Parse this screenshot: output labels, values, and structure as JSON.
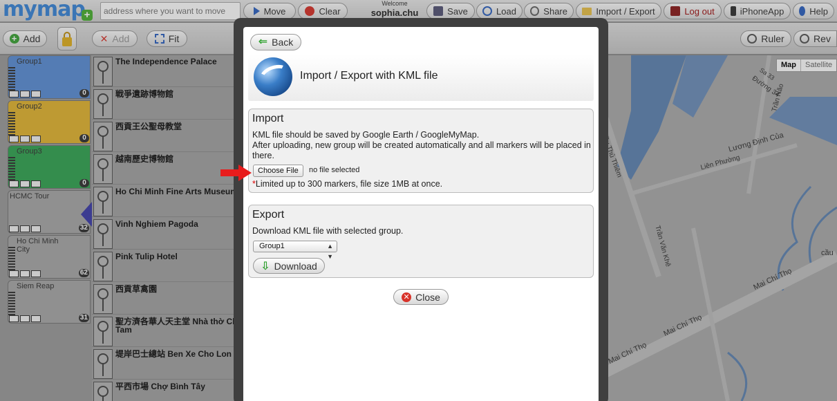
{
  "topbar": {
    "logo": "mymap",
    "address_placeholder": "address where you want to move",
    "buttons": {
      "move": "Move",
      "clear": "Clear",
      "save": "Save",
      "load": "Load",
      "share": "Share",
      "import_export": "Import / Export",
      "logout": "Log out",
      "iphone": "iPhoneApp",
      "help": "Help"
    },
    "welcome_label": "Welcome",
    "username": "sophia.chu"
  },
  "toolbar2": {
    "add": "Add",
    "add_disabled": "Add",
    "fit": "Fit",
    "ruler": "Ruler",
    "rev": "Rev"
  },
  "groups": [
    {
      "name": "Group1",
      "count": "0",
      "color": "#5b8fd6"
    },
    {
      "name": "Group2",
      "count": "0",
      "color": "#e3b531"
    },
    {
      "name": "Group3",
      "count": "0",
      "color": "#32a452"
    },
    {
      "name": "HCMC Tour",
      "count": "32",
      "color": "#a8a8a8"
    },
    {
      "name": "Ho Chi Minh City",
      "count": "62",
      "color": "#a8a8a8"
    },
    {
      "name": "Siem Reap",
      "count": "31",
      "color": "#a8a8a8"
    }
  ],
  "markers": [
    "The Independence Palace",
    "戦爭遺跡博物館",
    "西貢王公聖母教堂",
    "越南歷史博物館",
    "Ho Chi Minh Fine Arts Museum",
    "Vinh Nghiem Pagoda",
    "Pink Tulip Hotel",
    "西貢草禽園",
    "聖方濟各華人天主堂 Nhà thờ Cha Tam",
    "堤岸巴士總站 Ben Xe Cho Lon",
    "平西市場 Chợ Bình Tây"
  ],
  "map": {
    "toggle_map": "Map",
    "toggle_satellite": "Satellite",
    "streets": [
      "Cầu Thủ Thiêm",
      "Liên Phường",
      "Lương Định Của",
      "Trần Não",
      "Đường 34",
      "Sa 33",
      "Trần Văn Khê",
      "Mai Chí Thọ",
      "Mai Chí Thọ",
      "Mai Chí Thọ",
      "cầu"
    ]
  },
  "modal": {
    "back": "Back",
    "title": "Import / Export with KML file",
    "import": {
      "heading": "Import",
      "line1": "KML file should be saved by Google Earth / GoogleMyMap.",
      "line2": "After uploading, new group will be created automatically and all markers will be placed in there.",
      "choose_file": "Choose File",
      "no_file": "no file selected",
      "star": "*",
      "limit": "Limited up to 300 markers, file size 1MB at once."
    },
    "export": {
      "heading": "Export",
      "desc": "Download KML file with selected group.",
      "selected_group": "Group1",
      "download": "Download"
    },
    "close": "Close"
  }
}
